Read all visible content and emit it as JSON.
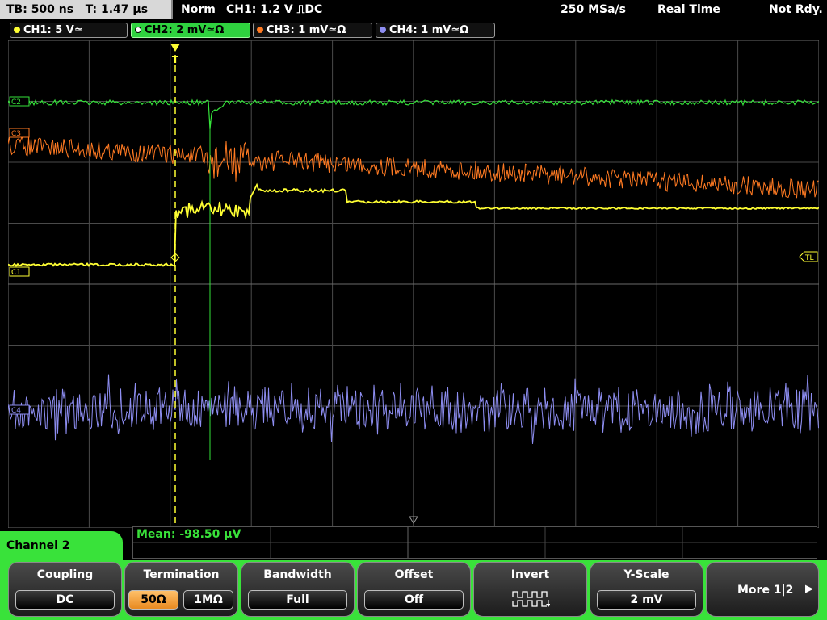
{
  "status": {
    "timebase": "TB: 500 ns   T: 1.47 µs",
    "mode": "Norm",
    "trigger": "CH1: 1.2 V ⎍DC",
    "sample_rate": "250 MSa/s",
    "acquisition": "Real Time",
    "state": "Not Rdy."
  },
  "channels": [
    {
      "label": "CH1: 5 V≃",
      "color": "#ffff33"
    },
    {
      "label": "CH2: 2 mV≃Ω",
      "color": "#35e23a"
    },
    {
      "label": "CH3: 1 mV≃Ω",
      "color": "#ff7a22"
    },
    {
      "label": "CH4: 1 mV≃Ω",
      "color": "#8e8ef2"
    }
  ],
  "markers": {
    "c1": "C1",
    "c2": "C2",
    "c3": "C3",
    "c4": "C4",
    "trigger_level": "TL",
    "trigger_pos": "T"
  },
  "measurement": {
    "text": "Mean: -98.50 µV"
  },
  "menu": {
    "channel": "Channel 2",
    "coupling_title": "Coupling",
    "coupling_value": "DC",
    "termination_title": "Termination",
    "termination_options": [
      "50Ω",
      "1MΩ"
    ],
    "bandwidth_title": "Bandwidth",
    "bandwidth_value": "Full",
    "offset_title": "Offset",
    "offset_value": "Off",
    "invert_title": "Invert",
    "yscale_title": "Y-Scale",
    "yscale_value": "2 mV",
    "more_label": "More 1|2"
  },
  "colors": {
    "grid": "#4a4a4a",
    "accent": "#39e23a",
    "selected_option": "#f0a040"
  }
}
